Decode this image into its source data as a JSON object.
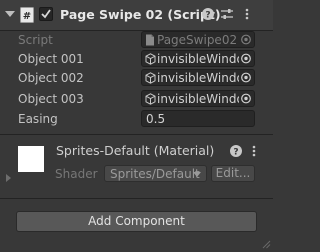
{
  "component": {
    "title": "Page Swipe 02 (Script)",
    "enabled": true
  },
  "fields": {
    "script": {
      "label": "Script",
      "value": "PageSwipe02"
    },
    "objects": [
      {
        "label": "Object 001",
        "value": "invisibleWindow"
      },
      {
        "label": "Object 002",
        "value": "invisibleWindow"
      },
      {
        "label": "Object 003",
        "value": "invisibleWindow"
      }
    ],
    "easing": {
      "label": "Easing",
      "value": "0.5"
    }
  },
  "material": {
    "title": "Sprites-Default (Material)",
    "shader_label": "Shader",
    "shader_value": "Sprites/Default",
    "edit_label": "Edit..."
  },
  "add_component_label": "Add Component",
  "colors": {
    "background": "#383838",
    "header": "#3e3e3e",
    "field": "#2a2a2a",
    "button": "#585858"
  },
  "icons": [
    "foldout-arrow-icon",
    "script-icon",
    "checkmark-icon",
    "help-icon",
    "presets-icon",
    "kebab-menu-icon",
    "gameobject-icon",
    "object-picker-icon"
  ]
}
